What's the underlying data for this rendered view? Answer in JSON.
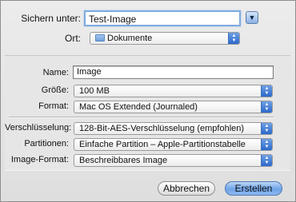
{
  "header": {
    "save_as_label": "Sichern unter:",
    "save_as_value": "Test-Image",
    "location_label": "Ort:",
    "location_value": "Dokumente",
    "folder_icon": "folder-icon",
    "disclosure_icon": "triangle-down-icon"
  },
  "options": {
    "name_label": "Name:",
    "name_value": "Image",
    "size_label": "Größe:",
    "size_value": "100 MB",
    "format_label": "Format:",
    "format_value": "Mac OS Extended (Journaled)",
    "encryption_label": "Verschlüsselung:",
    "encryption_value": "128-Bit-AES-Verschlüsselung (empfohlen)",
    "partitions_label": "Partitionen:",
    "partitions_value": "Einfache Partition – Apple-Partitionstabelle",
    "image_format_label": "Image-Format:",
    "image_format_value": "Beschreibbares Image"
  },
  "buttons": {
    "cancel": "Abbrechen",
    "create": "Erstellen"
  },
  "colors": {
    "accent": "#3f7ad6",
    "focus_ring": "#7eaadf"
  }
}
